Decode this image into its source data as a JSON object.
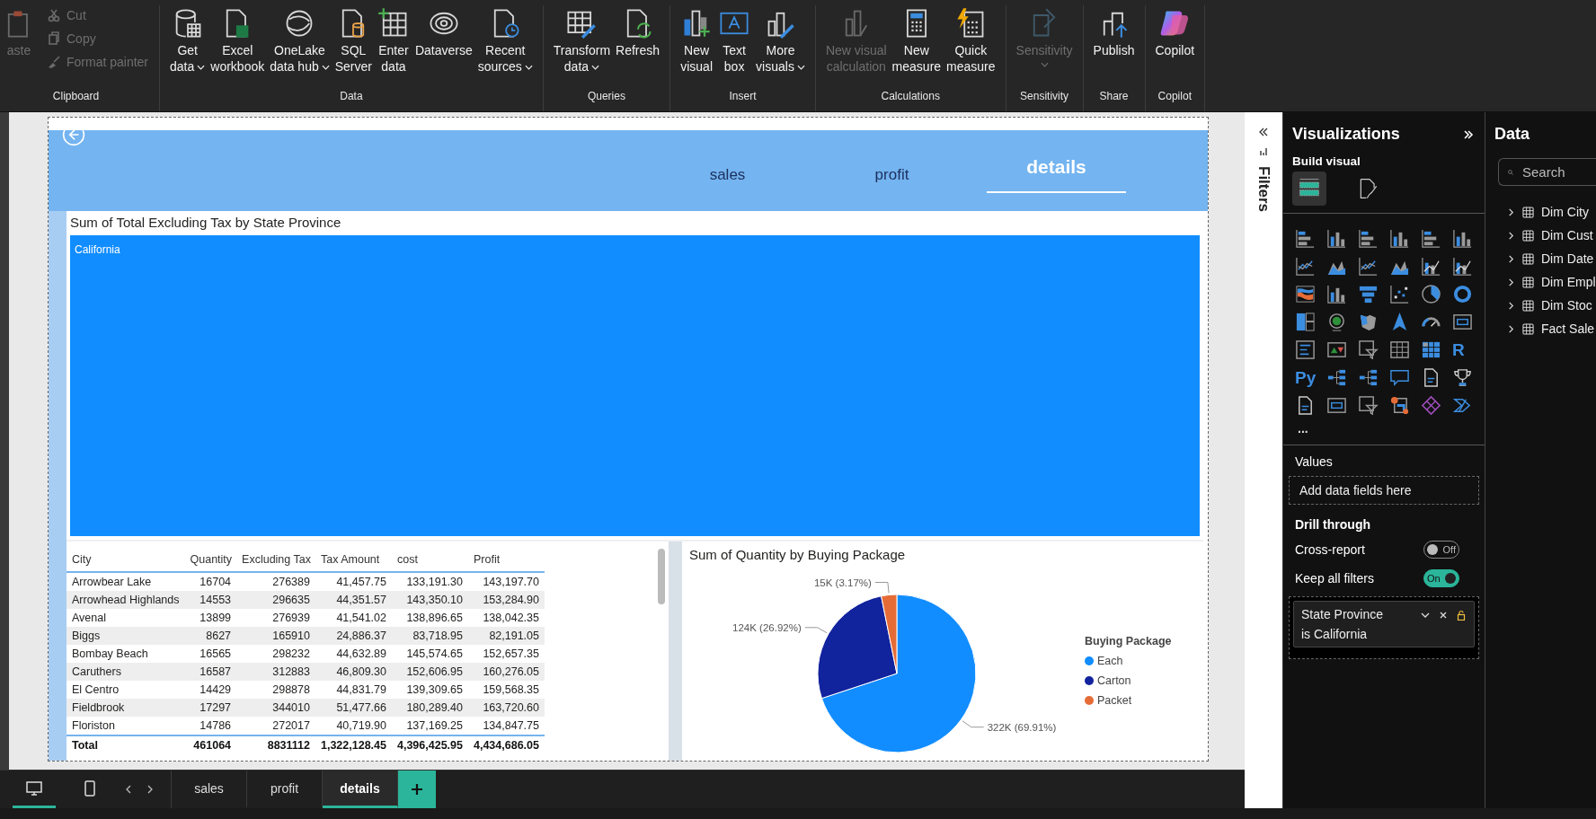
{
  "ribbon": {
    "groups": [
      {
        "name": "Clipboard",
        "buttons": [
          {
            "kind": "large",
            "label": "aste",
            "disabled": true,
            "dropdown": false
          },
          {
            "kind": "small",
            "label": "Cut",
            "disabled": true
          },
          {
            "kind": "small",
            "label": "Copy",
            "disabled": true
          },
          {
            "kind": "small",
            "label": "Format painter",
            "disabled": true
          }
        ]
      },
      {
        "name": "Data",
        "buttons": [
          {
            "kind": "large",
            "label": "Get\ndata",
            "disabled": false,
            "dropdown": true
          },
          {
            "kind": "large",
            "label": "Excel\nworkbook",
            "disabled": false,
            "dropdown": false
          },
          {
            "kind": "large",
            "label": "OneLake\ndata hub",
            "disabled": false,
            "dropdown": true
          },
          {
            "kind": "large",
            "label": "SQL\nServer",
            "disabled": false,
            "dropdown": false
          },
          {
            "kind": "large",
            "label": "Enter\ndata",
            "disabled": false,
            "dropdown": false
          },
          {
            "kind": "large",
            "label": "Dataverse",
            "disabled": false,
            "dropdown": false
          },
          {
            "kind": "large",
            "label": "Recent\nsources",
            "disabled": false,
            "dropdown": true
          }
        ]
      },
      {
        "name": "Queries",
        "buttons": [
          {
            "kind": "large",
            "label": "Transform\ndata",
            "disabled": false,
            "dropdown": true
          },
          {
            "kind": "large",
            "label": "Refresh",
            "disabled": false,
            "dropdown": false
          }
        ]
      },
      {
        "name": "Insert",
        "buttons": [
          {
            "kind": "large",
            "label": "New\nvisual",
            "disabled": false,
            "dropdown": false
          },
          {
            "kind": "large",
            "label": "Text\nbox",
            "disabled": false,
            "dropdown": false
          },
          {
            "kind": "large",
            "label": "More\nvisuals",
            "disabled": false,
            "dropdown": true
          }
        ]
      },
      {
        "name": "Calculations",
        "buttons": [
          {
            "kind": "large",
            "label": "New visual\ncalculation",
            "disabled": true,
            "dropdown": false
          },
          {
            "kind": "large",
            "label": "New\nmeasure",
            "disabled": false,
            "dropdown": false
          },
          {
            "kind": "large",
            "label": "Quick\nmeasure",
            "disabled": false,
            "dropdown": false
          }
        ]
      },
      {
        "name": "Sensitivity",
        "buttons": [
          {
            "kind": "large",
            "label": "Sensitivity",
            "disabled": true,
            "dropdown": true
          }
        ]
      },
      {
        "name": "Share",
        "buttons": [
          {
            "kind": "large",
            "label": "Publish",
            "disabled": false,
            "dropdown": false
          }
        ]
      },
      {
        "name": "Copilot",
        "buttons": [
          {
            "kind": "large",
            "label": "Copilot",
            "disabled": false,
            "dropdown": false
          }
        ]
      }
    ]
  },
  "report": {
    "nav_tabs": [
      {
        "label": "sales",
        "selected": false
      },
      {
        "label": "profit",
        "selected": false
      },
      {
        "label": "details",
        "selected": true
      }
    ],
    "treemap": {
      "title": "Sum of Total Excluding Tax by State Province",
      "items": [
        {
          "label": "California"
        }
      ]
    },
    "table": {
      "columns": [
        "City",
        "Quantity",
        "Excluding Tax",
        "Tax Amount",
        "cost",
        "Profit"
      ],
      "rows": [
        [
          "Arrowbear Lake",
          "16704",
          "276389",
          "41,457.75",
          "133,191.30",
          "143,197.70"
        ],
        [
          "Arrowhead Highlands",
          "14553",
          "296635",
          "44,351.57",
          "143,350.10",
          "153,284.90"
        ],
        [
          "Avenal",
          "13899",
          "276939",
          "41,541.02",
          "138,896.65",
          "138,042.35"
        ],
        [
          "Biggs",
          "8627",
          "165910",
          "24,886.37",
          "83,718.95",
          "82,191.05"
        ],
        [
          "Bombay Beach",
          "16565",
          "298232",
          "44,632.89",
          "145,574.65",
          "152,657.35"
        ],
        [
          "Caruthers",
          "16587",
          "312883",
          "46,809.30",
          "152,606.95",
          "160,276.05"
        ],
        [
          "El Centro",
          "14429",
          "298878",
          "44,831.79",
          "139,309.65",
          "159,568.35"
        ],
        [
          "Fieldbrook",
          "17297",
          "344010",
          "51,477.66",
          "180,289.40",
          "163,720.60"
        ],
        [
          "Floriston",
          "14786",
          "272017",
          "40,719.90",
          "137,169.25",
          "134,847.75"
        ]
      ],
      "total": [
        "Total",
        "461064",
        "8831112",
        "1,322,128.45",
        "4,396,425.95",
        "4,434,686.05"
      ]
    },
    "pie": {
      "chart_data": {
        "type": "pie",
        "title": "Sum of Quantity by Buying Package",
        "series": [
          {
            "values": [
              69.91,
              26.92,
              3.17
            ]
          }
        ],
        "value_labels": [
          "322K (69.91%)",
          "124K (26.92%)",
          "15K (3.17%)"
        ]
      },
      "legend": {
        "title": "Buying Package",
        "items": [
          {
            "label": "Each",
            "color": "#118dff"
          },
          {
            "label": "Carton",
            "color": "#12239e"
          },
          {
            "label": "Packet",
            "color": "#e66c37"
          }
        ]
      }
    }
  },
  "page_tabs": {
    "views": [
      {
        "selected": true
      },
      {
        "selected": false
      }
    ],
    "tabs": [
      {
        "label": "sales",
        "selected": false
      },
      {
        "label": "profit",
        "selected": false
      },
      {
        "label": "details",
        "selected": true
      }
    ]
  },
  "filters_pane": {
    "title": "Filters"
  },
  "visualizations": {
    "title": "Visualizations",
    "subtitle": "Build visual",
    "modes": [
      {
        "selected": true
      },
      {
        "selected": false
      }
    ],
    "gallery": [
      {
        "kind": "icon"
      },
      {
        "kind": "icon"
      },
      {
        "kind": "icon"
      },
      {
        "kind": "icon"
      },
      {
        "kind": "icon"
      },
      {
        "kind": "icon"
      },
      {
        "kind": "icon"
      },
      {
        "kind": "icon"
      },
      {
        "kind": "icon"
      },
      {
        "kind": "icon"
      },
      {
        "kind": "icon"
      },
      {
        "kind": "icon"
      },
      {
        "kind": "icon"
      },
      {
        "kind": "icon"
      },
      {
        "kind": "icon"
      },
      {
        "kind": "icon"
      },
      {
        "kind": "icon"
      },
      {
        "kind": "icon"
      },
      {
        "kind": "icon"
      },
      {
        "kind": "icon"
      },
      {
        "kind": "icon"
      },
      {
        "kind": "icon"
      },
      {
        "kind": "icon"
      },
      {
        "kind": "icon"
      },
      {
        "kind": "icon"
      },
      {
        "kind": "icon"
      },
      {
        "kind": "icon"
      },
      {
        "kind": "icon"
      },
      {
        "kind": "icon"
      },
      {
        "kind": "glyph",
        "text": "R"
      },
      {
        "kind": "glyph",
        "text": "Py"
      },
      {
        "kind": "icon"
      },
      {
        "kind": "icon"
      },
      {
        "kind": "icon"
      },
      {
        "kind": "icon"
      },
      {
        "kind": "icon"
      },
      {
        "kind": "icon"
      },
      {
        "kind": "icon"
      },
      {
        "kind": "icon"
      },
      {
        "kind": "icon"
      },
      {
        "kind": "icon"
      },
      {
        "kind": "icon"
      }
    ],
    "more": "...",
    "values_label": "Values",
    "drop_placeholder": "Add data fields here",
    "drill_title": "Drill through",
    "toggles": [
      {
        "label": "Cross-report",
        "on": false,
        "text": "Off"
      },
      {
        "label": "Keep all filters",
        "on": true,
        "text": "On"
      }
    ],
    "filter_card": {
      "field": "State Province",
      "condition": "is California"
    }
  },
  "data_pane": {
    "title": "Data",
    "search_placeholder": "Search",
    "tables": [
      {
        "label": "Dim City",
        "expanded": false
      },
      {
        "label": "Dim Cust",
        "expanded": false
      },
      {
        "label": "Dim Date",
        "expanded": false
      },
      {
        "label": "Dim Empl",
        "expanded": false
      },
      {
        "label": "Dim Stoc",
        "expanded": false
      },
      {
        "label": "Fact Sale",
        "expanded": false
      }
    ]
  }
}
